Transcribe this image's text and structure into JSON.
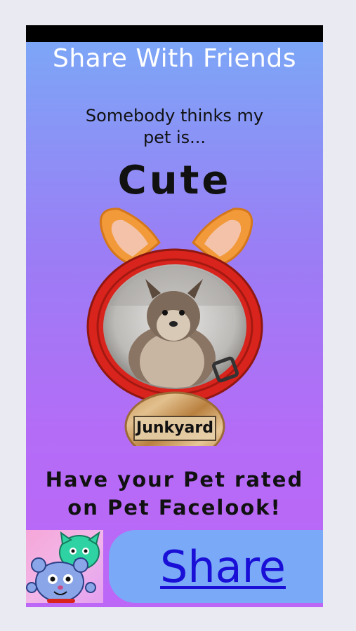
{
  "header": {
    "title": "Share With Friends"
  },
  "content": {
    "subtitle": "Somebody thinks my pet is...",
    "rating": "Cute",
    "pet_name": "Junkyard",
    "promo": "Have your Pet rated on Pet Facelook!"
  },
  "actions": {
    "share_label": "Share"
  },
  "icons": {
    "pet_frame": "cat-ears-collar-frame",
    "app_icon": "cartoon-cats-app-icon"
  },
  "colors": {
    "gradient_top": "#7aa9f7",
    "gradient_bottom": "#bd67f7",
    "share_button": "#7aa9f7",
    "share_text": "#1a0fd6",
    "collar_red": "#d8241c"
  }
}
